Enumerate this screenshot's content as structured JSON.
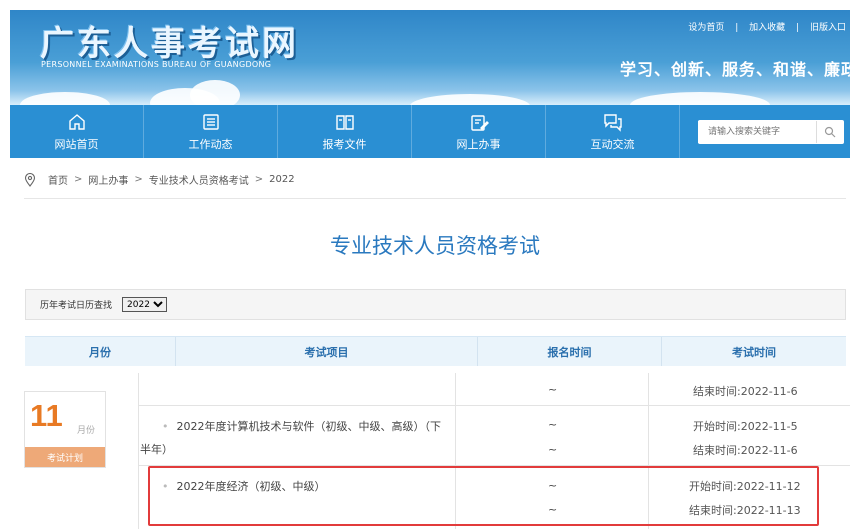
{
  "header": {
    "logo_cn": "广东人事考试网",
    "logo_en": "PERSONNEL EXAMINATIONS BUREAU OF GUANGDONG",
    "links": [
      "设为首页",
      "|",
      "加入收藏",
      "|",
      "旧版入口"
    ],
    "slogan": "学习、创新、服务、和谐、廉政"
  },
  "nav": {
    "items": [
      {
        "label": "网站首页",
        "icon": "home-icon"
      },
      {
        "label": "工作动态",
        "icon": "list-icon"
      },
      {
        "label": "报考文件",
        "icon": "book-icon"
      },
      {
        "label": "网上办事",
        "icon": "clipboard-edit-icon"
      },
      {
        "label": "互动交流",
        "icon": "chat-icon"
      }
    ],
    "search_placeholder": "请输入搜索关键字"
  },
  "breadcrumb": {
    "items": [
      "首页",
      "网上办事",
      "专业技术人员资格考试",
      "2022"
    ],
    "sep": ">"
  },
  "page_title": "专业技术人员资格考试",
  "filter": {
    "label": "历年考试日历查找",
    "year": "2022"
  },
  "table": {
    "headers": [
      "月份",
      "考试项目",
      "报名时间",
      "考试时间"
    ],
    "month": {
      "day": "11",
      "unit": "月份",
      "tag": "考试计划"
    },
    "rows": [
      {
        "project": "",
        "project_line2": "",
        "signup": [
          "~"
        ],
        "exam": [
          "结束时间:2022-11-6"
        ]
      },
      {
        "project": "2022年度计算机技术与软件（初级、中级、高级）（下",
        "project_line2": "半年）",
        "signup": [
          "~",
          "~"
        ],
        "exam": [
          "开始时间:2022-11-5",
          "结束时间:2022-11-6"
        ]
      },
      {
        "project": "2022年度经济（初级、中级）",
        "project_line2": "",
        "signup": [
          "~",
          "~"
        ],
        "exam": [
          "开始时间:2022-11-12",
          "结束时间:2022-11-13"
        ]
      }
    ]
  },
  "colors": {
    "primary": "#2a8fd3",
    "title": "#2a79bf",
    "accent": "#e87a24",
    "highlight": "#e23b3b"
  }
}
